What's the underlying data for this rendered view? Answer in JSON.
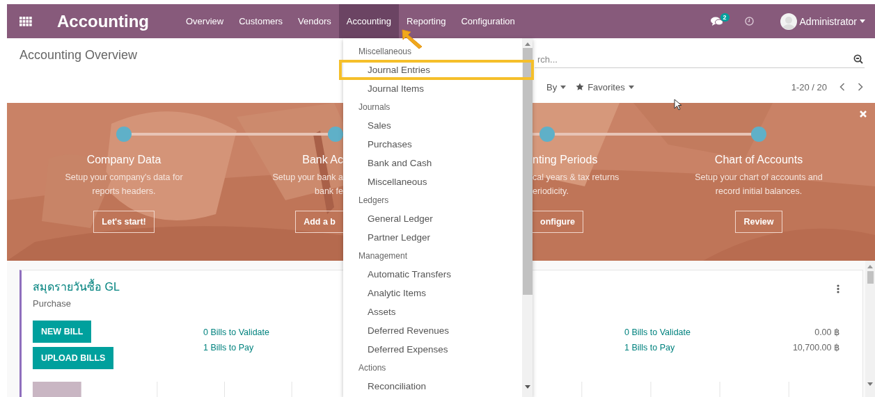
{
  "navbar": {
    "app_name": "Accounting",
    "menu": [
      {
        "label": "Overview",
        "selected": false
      },
      {
        "label": "Customers",
        "selected": false
      },
      {
        "label": "Vendors",
        "selected": false
      },
      {
        "label": "Accounting",
        "selected": true
      },
      {
        "label": "Reporting",
        "selected": false
      },
      {
        "label": "Configuration",
        "selected": false
      }
    ],
    "message_count": "2",
    "user": "Administrator"
  },
  "control_panel": {
    "breadcrumb": "Accounting Overview",
    "search": {
      "placeholder": "rch..."
    },
    "filters": [
      {
        "label": "By",
        "starred": false
      },
      {
        "label": "Favorites",
        "starred": true
      }
    ],
    "pager": "1-20 / 20"
  },
  "banner": {
    "steps": [
      {
        "title": "Company Data",
        "description_lines": [
          "Setup your company's data for",
          "reports headers."
        ],
        "button": "Let's start!",
        "kind": "full"
      },
      {
        "title": "Bank Ac",
        "description_lines": [
          "Setup your bank a",
          "bank fe"
        ],
        "button": "Add a b",
        "kind": "cut_end"
      },
      {
        "title": "nting Periods",
        "description_lines": [
          "cal years & tax returns",
          "eriodicity."
        ],
        "button": "onfigure",
        "kind": "cut_start"
      },
      {
        "title": "Chart of Accounts",
        "description_lines": [
          "Setup your chart of accounts and",
          "record initial balances."
        ],
        "button": "Review",
        "kind": "full"
      }
    ]
  },
  "dropdown": {
    "sections": [
      {
        "heading": "Miscellaneous",
        "items": [
          {
            "label": "Journal Entries",
            "highlighted": true
          },
          {
            "label": "Journal Items",
            "highlighted": false
          }
        ]
      },
      {
        "heading": "Journals",
        "items": [
          {
            "label": "Sales",
            "highlighted": false
          },
          {
            "label": "Purchases",
            "highlighted": false
          },
          {
            "label": "Bank and Cash",
            "highlighted": false
          },
          {
            "label": "Miscellaneous",
            "highlighted": false
          }
        ]
      },
      {
        "heading": "Ledgers",
        "items": [
          {
            "label": "General Ledger",
            "highlighted": false
          },
          {
            "label": "Partner Ledger",
            "highlighted": false
          }
        ]
      },
      {
        "heading": "Management",
        "items": [
          {
            "label": "Automatic Transfers",
            "highlighted": false
          },
          {
            "label": "Analytic Items",
            "highlighted": false
          },
          {
            "label": "Assets",
            "highlighted": false
          },
          {
            "label": "Deferred Revenues",
            "highlighted": false
          },
          {
            "label": "Deferred Expenses",
            "highlighted": false
          }
        ]
      },
      {
        "heading": "Actions",
        "items": [
          {
            "label": "Reconciliation",
            "highlighted": false
          }
        ]
      }
    ]
  },
  "journals": [
    {
      "title": "สมุดรายวันซื้อ GL",
      "subtitle": "Purchase",
      "buttons": [
        "NEW BILL",
        "UPLOAD BILLS"
      ],
      "options_menu": false,
      "stats": [
        {
          "label": "0 Bills to Validate"
        },
        {
          "label": "1 Bills to Pay"
        }
      ]
    },
    {
      "options_menu": true,
      "stats": [
        {
          "label": "0 Bills to Validate",
          "amount": "0.00 ฿"
        },
        {
          "label": "1 Bills to Pay",
          "amount": "10,700.00 ฿"
        }
      ]
    }
  ]
}
